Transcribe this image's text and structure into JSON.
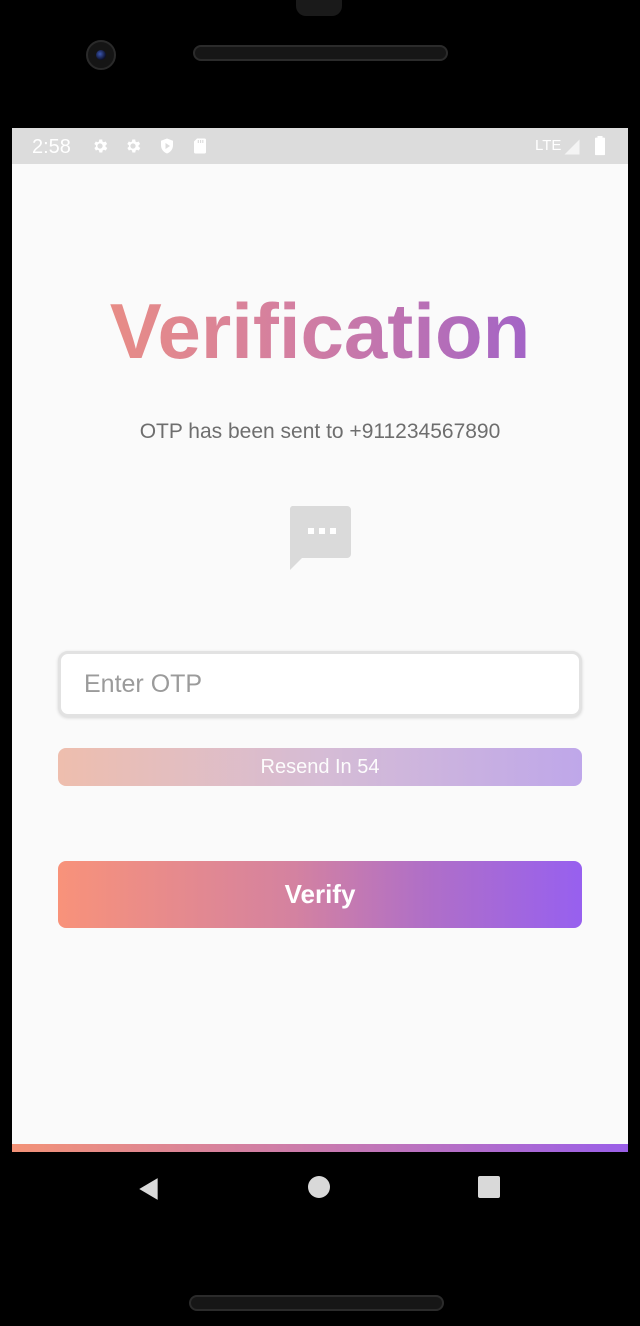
{
  "status_bar": {
    "time": "2:58",
    "network": "LTE",
    "icons": [
      "gear-icon",
      "gear-icon",
      "play-protect-icon",
      "sd-card-icon",
      "signal-icon",
      "battery-icon"
    ]
  },
  "header": {
    "title": "Verification",
    "subtitle": "OTP has been sent to +911234567890"
  },
  "message_icon": "chat-bubble-icon",
  "otp_input": {
    "placeholder": "Enter OTP",
    "value": ""
  },
  "resend": {
    "label": "Resend In 54"
  },
  "verify_button": {
    "label": "Verify"
  },
  "colors": {
    "gradient_start": "#f8927a",
    "gradient_mid": "#d482a0",
    "gradient_end": "#9760ef",
    "background": "#fafafa"
  },
  "nav_bar": {
    "icons": [
      "back-icon",
      "home-icon",
      "recents-icon"
    ]
  }
}
